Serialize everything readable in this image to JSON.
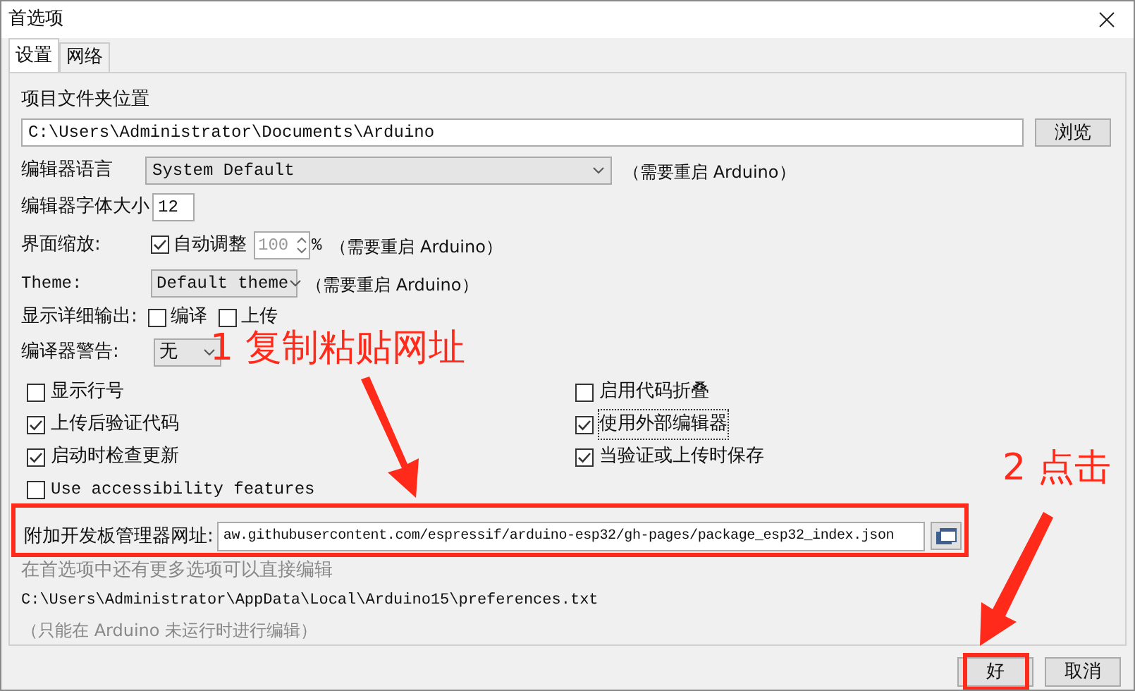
{
  "window": {
    "title": "首选项"
  },
  "tabs": [
    {
      "label": "设置",
      "selected": true
    },
    {
      "label": "网络",
      "selected": false
    }
  ],
  "sketchbook": {
    "label": "项目文件夹位置",
    "value": "C:\\Users\\Administrator\\Documents\\Arduino",
    "button": "浏览"
  },
  "editor_language": {
    "label": "编辑器语言",
    "value": "System Default",
    "note": "（需要重启 Arduino）"
  },
  "font_size": {
    "label": "编辑器字体大小",
    "value": "12"
  },
  "scaling": {
    "label": "界面缩放:",
    "auto_label": "自动调整",
    "auto_checked": true,
    "value": "100",
    "unit": "%",
    "note": "（需要重启 Arduino）"
  },
  "theme": {
    "label": "Theme:",
    "value": "Default theme",
    "note": "（需要重启 Arduino）"
  },
  "verbose": {
    "label": "显示详细输出:",
    "options": [
      {
        "label": "编译",
        "checked": false
      },
      {
        "label": "上传",
        "checked": false
      }
    ]
  },
  "warnings": {
    "label": "编译器警告:",
    "value": "无"
  },
  "options_left": [
    {
      "label": "显示行号",
      "checked": false,
      "focused": false
    },
    {
      "label": "上传后验证代码",
      "checked": true,
      "focused": false
    },
    {
      "label": "启动时检查更新",
      "checked": true,
      "focused": false
    },
    {
      "label": "Use accessibility features",
      "checked": false,
      "focused": false
    }
  ],
  "options_right": [
    {
      "label": "启用代码折叠",
      "checked": false,
      "focused": false
    },
    {
      "label": "使用外部编辑器",
      "checked": true,
      "focused": true
    },
    {
      "label": "当验证或上传时保存",
      "checked": true,
      "focused": false
    }
  ],
  "board_urls": {
    "label": "附加开发板管理器网址:",
    "value": "aw.githubusercontent.com/espressif/arduino-esp32/gh-pages/package_esp32_index.json"
  },
  "hint": "在首选项中还有更多选项可以直接编辑",
  "prefs_path": "C:\\Users\\Administrator\\AppData\\Local\\Arduino15\\preferences.txt",
  "note": "（只能在 Arduino 未运行时进行编辑）",
  "buttons": [
    {
      "label": "好"
    },
    {
      "label": "取消"
    }
  ],
  "annotations": [
    {
      "text": "1 复制粘贴网址"
    },
    {
      "text": "2 点击"
    }
  ]
}
